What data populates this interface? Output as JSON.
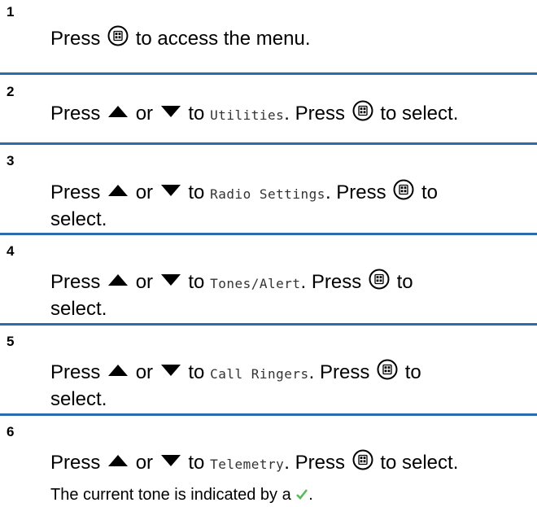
{
  "steps": [
    {
      "number": "1",
      "parts": {
        "a": "Press",
        "b": "to access the menu."
      }
    },
    {
      "number": "2",
      "parts": {
        "press": "Press",
        "or": "or",
        "to": "to",
        "target": "Utilities",
        "press2": ". Press",
        "end": "to select."
      }
    },
    {
      "number": "3",
      "parts": {
        "press": "Press",
        "or": "or",
        "to": "to",
        "target": "Radio Settings",
        "press2": ". Press",
        "end": "to",
        "cont": "select."
      }
    },
    {
      "number": "4",
      "parts": {
        "press": "Press",
        "or": "or",
        "to": "to",
        "target": "Tones/Alert",
        "press2": ". Press",
        "end": "to",
        "cont": "select."
      }
    },
    {
      "number": "5",
      "parts": {
        "press": "Press",
        "or": "or",
        "to": "to",
        "target": "Call Ringers",
        "press2": ". Press",
        "end": "to",
        "cont": "select."
      }
    },
    {
      "number": "6",
      "parts": {
        "press": "Press",
        "or": "or",
        "to": "to",
        "target": "Telemetry",
        "press2": ". Press",
        "end": "to select."
      }
    }
  ],
  "note": {
    "text": "The current tone is indicated by a",
    "end": "."
  },
  "icons": {
    "menu_button": "menu-ok-button-icon",
    "up": "up-arrow-icon",
    "down": "down-arrow-icon",
    "check": "checkmark-icon"
  },
  "colors": {
    "rule": "#2b6cb0",
    "check": "#5cb85c"
  }
}
